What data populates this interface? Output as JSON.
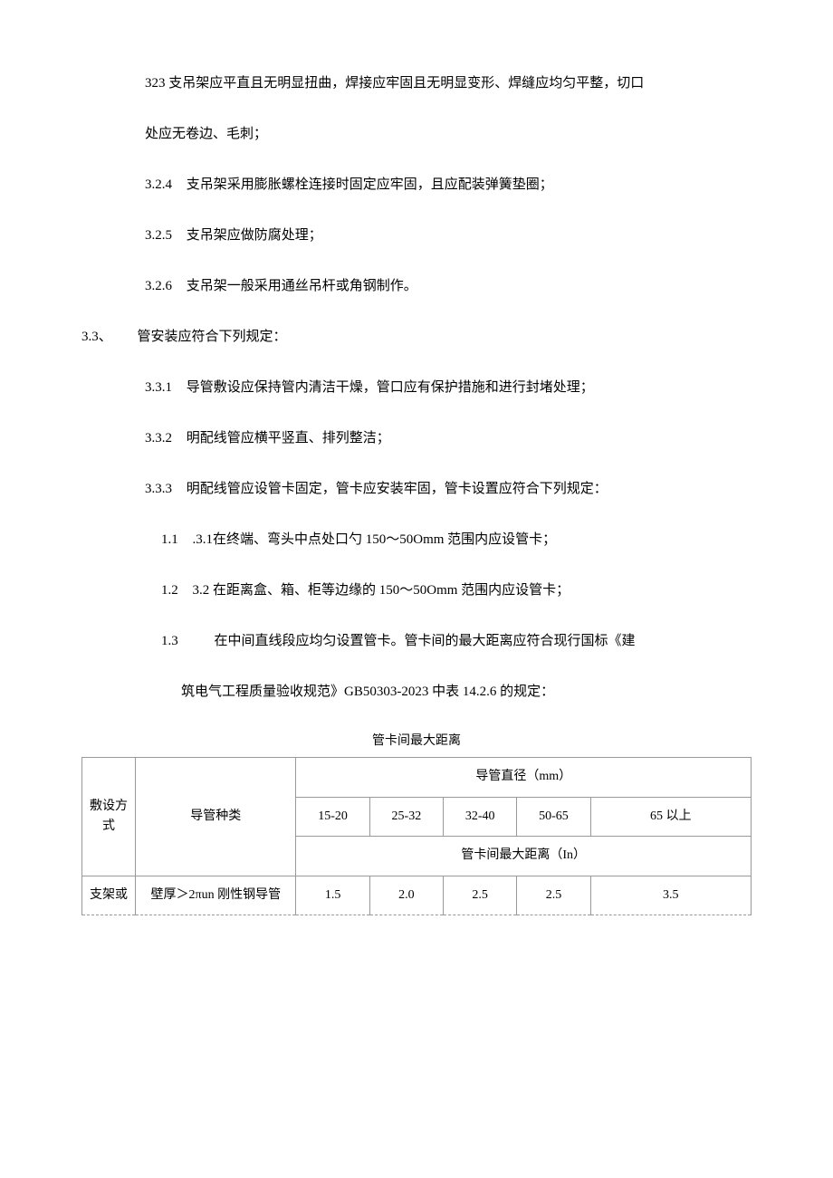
{
  "p323": "323 支吊架应平直且无明显扭曲，焊接应牢固且无明显变形、焊缝应均匀平整，切口",
  "p323_cont": "处应无卷边、毛刺；",
  "p324_num": "3.2.4",
  "p324_text": "支吊架采用膨胀螺栓连接时固定应牢固，且应配装弹簧垫圈；",
  "p325_num": "3.2.5",
  "p325_text": "支吊架应做防腐处理；",
  "p326_num": "3.2.6",
  "p326_text": "支吊架一般采用通丝吊杆或角钢制作。",
  "p33_num": "3.3、",
  "p33_text": "管安装应符合下列规定：",
  "p331_num": "3.3.1",
  "p331_text": "导管敷设应保持管内清洁干燥，管口应有保护措施和进行封堵处理；",
  "p332_num": "3.3.2",
  "p332_text": "明配线管应横平竖直、排列整洁；",
  "p333_num": "3.3.3",
  "p333_text": "明配线管应设管卡固定，管卡应安装牢固，管卡设置应符合下列规定：",
  "p113_num": "1.1",
  "p113_text": ".3.1在终端、弯头中点处口勺 150～50Omm 范围内应设管卡；",
  "p123_num": "1.2",
  "p123_text": "3.2 在距离盒、箱、柜等边缘的 150～50Omm 范围内应设管卡；",
  "p13_num": "1.3",
  "p13_text": "在中间直线段应均匀设置管卡。管卡间的最大距离应符合现行国标《建",
  "p13_cont": "筑电气工程质量验收规范》GB50303-2023 中表 14.2.6 的规定：",
  "table_title": "管卡间最大距离",
  "chart_data": {
    "type": "table",
    "title": "管卡间最大距离",
    "columns": {
      "layout": "敷设方式",
      "kind": "导管种类",
      "diam_header": "导管直径（mm）",
      "diam_ranges": [
        "15-20",
        "25-32",
        "32-40",
        "50-65",
        "65 以上"
      ],
      "dist_header": "管卡间最大距离（In）"
    },
    "rows": [
      {
        "layout": "支架或",
        "kind": "壁厚＞2πun 刚性钢导管",
        "values": [
          "1.5",
          "2.0",
          "2.5",
          "2.5",
          "3.5"
        ]
      }
    ]
  }
}
